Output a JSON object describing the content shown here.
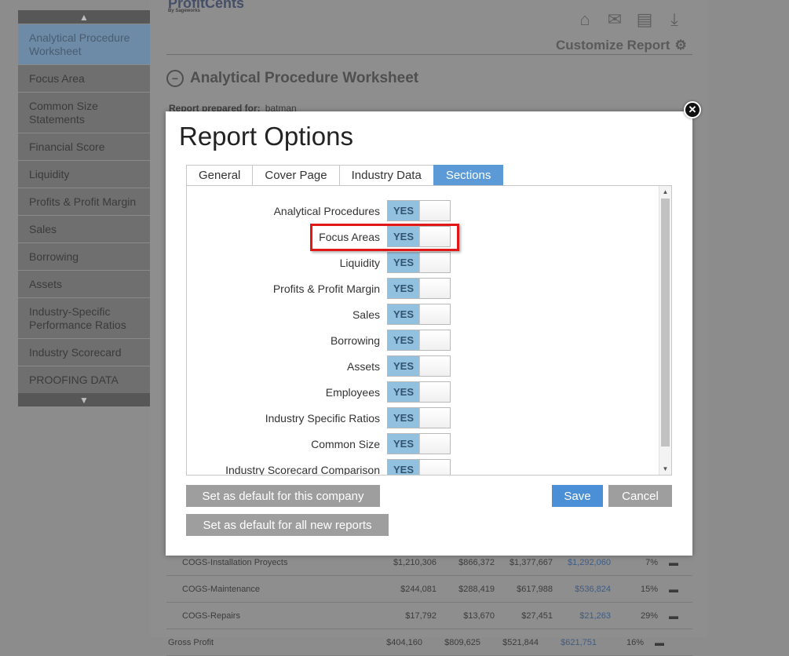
{
  "sidebar": {
    "items": [
      {
        "label": "Analytical Procedure Worksheet",
        "active": true
      },
      {
        "label": "Focus Area"
      },
      {
        "label": "Common Size Statements"
      },
      {
        "label": "Financial Score"
      },
      {
        "label": "Liquidity"
      },
      {
        "label": "Profits & Profit Margin"
      },
      {
        "label": "Sales"
      },
      {
        "label": "Borrowing"
      },
      {
        "label": "Assets"
      },
      {
        "label": "Industry-Specific Performance Ratios"
      },
      {
        "label": "Industry Scorecard"
      },
      {
        "label": "PROOFING DATA"
      }
    ]
  },
  "app": {
    "logo_text": "ProfitCents",
    "logo_sub": "By Sageworks",
    "customize_label": "Customize Report",
    "section_title": "Analytical Procedure Worksheet",
    "prepared_label": "Report prepared for:",
    "prepared_value": "batman"
  },
  "bg_table": {
    "rows": [
      {
        "label": "COGS-Installation Proyects",
        "c1": "$1,210,306",
        "c2": "$866,372",
        "c3": "$1,377,667",
        "c4": "$1,292,060",
        "pct": "7%"
      },
      {
        "label": "COGS-Maintenance",
        "c1": "$244,081",
        "c2": "$288,419",
        "c3": "$617,988",
        "c4": "$536,824",
        "pct": "15%"
      },
      {
        "label": "COGS-Repairs",
        "c1": "$17,792",
        "c2": "$13,670",
        "c3": "$27,451",
        "c4": "$21,263",
        "pct": "29%"
      },
      {
        "label": "Gross Profit",
        "c1": "$404,160",
        "c2": "$809,625",
        "c3": "$521,844",
        "c4": "$621,751",
        "pct": "16%"
      }
    ]
  },
  "modal": {
    "title": "Report Options",
    "close_glyph": "✕",
    "tabs": [
      "General",
      "Cover Page",
      "Industry Data",
      "Sections"
    ],
    "active_tab": "Sections",
    "toggle_on_label": "YES",
    "options": [
      "Analytical Procedures",
      "Focus Areas",
      "Liquidity",
      "Profits & Profit Margin",
      "Sales",
      "Borrowing",
      "Assets",
      "Employees",
      "Industry Specific Ratios",
      "Common Size",
      "Industry Scorecard Comparison"
    ],
    "highlighted_option": "Focus Areas",
    "buttons": {
      "default_company": "Set as default for this company",
      "default_all": "Set as default for all new reports",
      "save": "Save",
      "cancel": "Cancel"
    }
  },
  "colors": {
    "accent_blue": "#5b9ad6",
    "toggle_yes": "#92c1e0",
    "highlight_red": "#e01818"
  }
}
